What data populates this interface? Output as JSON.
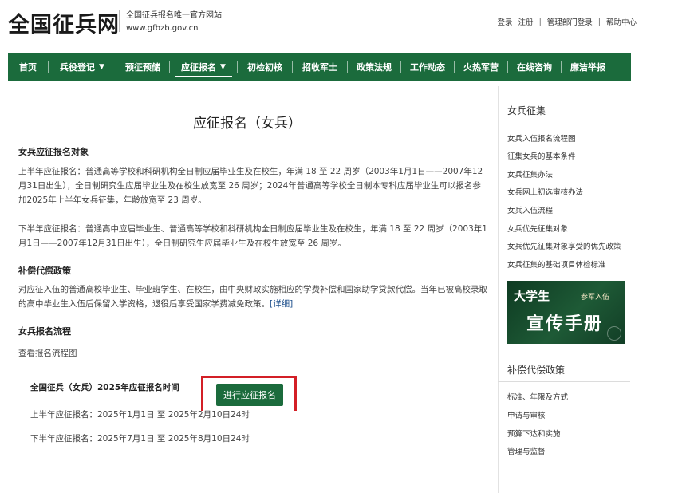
{
  "header": {
    "logo": "全国征兵网",
    "subtitle": "全国征兵报名唯一官方网站",
    "url": "www.gfbzb.gov.cn",
    "links": {
      "login": "登录",
      "register": "注册",
      "admin_login": "管理部门登录",
      "help": "帮助中心"
    }
  },
  "nav": {
    "items": [
      {
        "label": "首页"
      },
      {
        "label": "兵役登记",
        "chevron": "▼"
      },
      {
        "label": "预征预储"
      },
      {
        "label": "应征报名",
        "chevron": "▼"
      },
      {
        "label": "初检初核"
      },
      {
        "label": "招收军士"
      },
      {
        "label": "政策法规"
      },
      {
        "label": "工作动态"
      },
      {
        "label": "火热军营"
      },
      {
        "label": "在线咨询"
      },
      {
        "label": "廉洁举报"
      }
    ]
  },
  "main": {
    "title": "应征报名（女兵）",
    "sec1_heading": "女兵应征报名对象",
    "sec1_p1": "上半年应征报名：普通高等学校和科研机构全日制应届毕业生及在校生，年满 18 至 22 周岁（2003年1月1日——2007年12月31日出生），全日制研究生应届毕业生及在校生放宽至 26 周岁；2024年普通高等学校全日制本专科应届毕业生可以报名参加2025年上半年女兵征集，年龄放宽至 23 周岁。",
    "sec1_p2": "下半年应征报名：普通高中应届毕业生、普通高等学校和科研机构全日制应届毕业生及在校生，年满 18 至 22 周岁（2003年1月1日——2007年12月31日出生），全日制研究生应届毕业生及在校生放宽至 26 周岁。",
    "sec2_heading": "补偿代偿政策",
    "sec2_text": "对应征入伍的普通高校毕业生、毕业班学生、在校生，由中央财政实施相应的学费补偿和国家助学贷款代偿。当年已被高校录取的高中毕业生入伍后保留入学资格，退役后享受国家学费减免政策。",
    "sec2_more": "[详细]",
    "sec3_heading": "女兵报名流程",
    "sec3_link": "查看报名流程图",
    "time_heading": "全国征兵（女兵）2025年应征报名时间",
    "time_first": "上半年应征报名：2025年1月1日 至 2025年2月10日24时",
    "time_second": "下半年应征报名：2025年7月1日 至 2025年8月10日24时",
    "apply_button": "进行应征报名"
  },
  "sidebar": {
    "section1_title": "女兵征集",
    "section1_links": [
      "女兵入伍报名流程图",
      "征集女兵的基本条件",
      "女兵征集办法",
      "女兵网上初选审核办法",
      "女兵入伍流程",
      "女兵优先征集对象",
      "女兵优先征集对象享受的优先政策",
      "女兵征集的基础项目体检标准"
    ],
    "banner": {
      "line1": "大学生",
      "line1_small": "参军入伍",
      "line2": "宣传手册"
    },
    "section2_title": "补偿代偿政策",
    "section2_links": [
      "标准、年限及方式",
      "申请与审核",
      "预算下达和实施",
      "管理与监督"
    ]
  },
  "colors": {
    "nav_green": "#1b6b3c",
    "highlight_red": "#d31f26",
    "link_blue": "#1d4f8c"
  }
}
